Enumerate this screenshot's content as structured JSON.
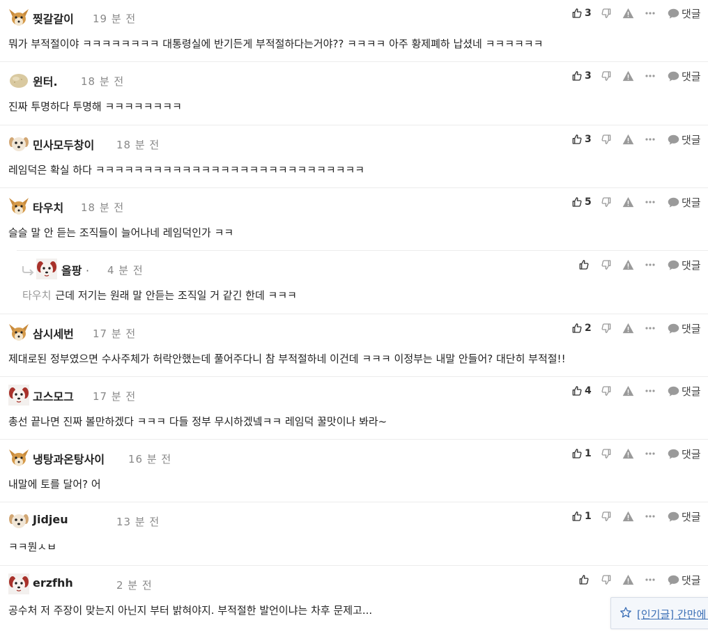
{
  "labels": {
    "reply": "댓글"
  },
  "comments": [
    {
      "nickname": "찢갈갈이",
      "time": "19 분 전",
      "text": "뭐가 부적절이야 ㅋㅋㅋㅋㅋㅋㅋㅋ 대통령실에 반기든게 부적절하다는거야?? ㅋㅋㅋㅋ 아주 황제폐하 납셨네 ㅋㅋㅋㅋㅋㅋ",
      "likes": "3",
      "avatar": "fox-avatar"
    },
    {
      "nickname": "윈터.",
      "time": "18 분 전",
      "text": "진짜 투명하다 투명해 ㅋㅋㅋㅋㅋㅋㅋㅋ",
      "likes": "3",
      "avatar": "potato-avatar"
    },
    {
      "nickname": "민사모두창이",
      "time": "18 분 전",
      "text": "레임덕은 확실 하다 ㅋㅋㅋㅋㅋㅋㅋㅋㅋㅋㅋㅋㅋㅋㅋㅋㅋㅋㅋㅋㅋㅋㅋㅋㅋㅋㅋㅋ",
      "likes": "3",
      "avatar": "puppy-avatar"
    },
    {
      "nickname": "타우치",
      "time": "18 분 전",
      "text": "슬슬 말 안 듣는 조직들이 늘어나네 레임덕인가 ㅋㅋ",
      "likes": "5",
      "avatar": "fox-avatar"
    },
    {
      "nickname": "올팡",
      "nick_suffix": "·",
      "time": "4 분 전",
      "mention": "타우치",
      "text": "근데 저기는 원래 말 안듣는 조직일 거 같긴 한데 ㅋㅋㅋ",
      "likes": "",
      "avatar": "dog-avatar",
      "is_reply": true
    },
    {
      "nickname": "삼시세번",
      "time": "17 분 전",
      "text": "제대로된 정부였으면 수사주체가 허락안했는데 풀어주다니 참 부적절하네 이건데 ㅋㅋㅋ 이정부는 내말 안들어? 대단히 부적절!!",
      "likes": "2",
      "avatar": "fox-avatar"
    },
    {
      "nickname": "고스모그",
      "time": "17 분 전",
      "text": "총선 끝나면 진짜 볼만하겠다 ㅋㅋㅋ 다들 정부 무시하겠넼ㅋㅋ 레임덕 꿀맛이나 봐라~",
      "likes": "4",
      "avatar": "dog-avatar"
    },
    {
      "nickname": "냉탕과온탕사이",
      "time": "16 분 전",
      "text": "내말에 토를 달어? 어",
      "likes": "1",
      "avatar": "fox-avatar"
    },
    {
      "nickname": "Jidjeu",
      "time": "13 분 전",
      "text": "ㅋㅋ뭔ㅅㅂ",
      "likes": "1",
      "avatar": "puppy-avatar"
    },
    {
      "nickname": "erzfhh",
      "time": "2 분 전",
      "text": "공수처 저 주장이 맞는지 아닌지 부터 밝혀야지. 부적절한 발언이냐는 차후 문제고...",
      "likes": "",
      "avatar": "dog-avatar"
    }
  ],
  "popular": {
    "text": "[인기글] 간만에 포"
  },
  "colors": {
    "accent_link": "#3b6fb6",
    "muted": "#888888",
    "icon": "#9a9a9a"
  }
}
